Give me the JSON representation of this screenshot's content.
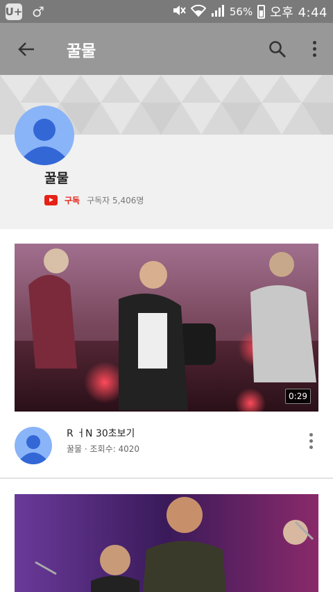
{
  "status_bar": {
    "carrier_icon": "U+",
    "gender_icon": "♂",
    "battery_percent": "56%",
    "clock": "오후 4:44"
  },
  "app_bar": {
    "title": "꿀물",
    "back_icon": "arrow-back-icon",
    "search_icon": "search-icon",
    "more_icon": "more-vert-icon"
  },
  "channel": {
    "name": "꿀물",
    "subscribe_label": "구독",
    "subscriber_count": "구독자 5,406명"
  },
  "videos": [
    {
      "title": "R ㅓN 30초보기",
      "meta": "꿀물 · 조회수: 4020",
      "duration": "0:29"
    }
  ],
  "colors": {
    "status_bar": "#7a7a7a",
    "app_bar": "#989898",
    "subscribe_red": "#e62117",
    "avatar_blue": "#8ab4f8"
  }
}
